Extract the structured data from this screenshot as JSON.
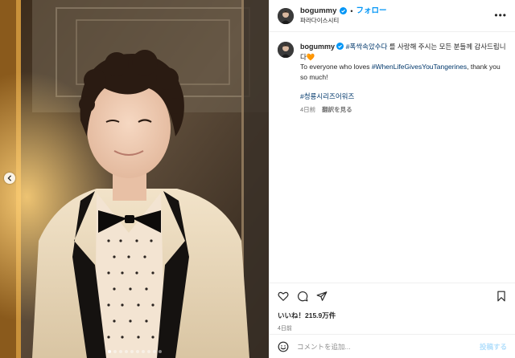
{
  "post": {
    "username": "bogummy",
    "follow_label": "フォロー",
    "separator": "•",
    "location": "파라다이스시티",
    "more_icon": "more-horizontal-icon",
    "caption": {
      "username": "bogummy",
      "hashtag_1": "#폭싹속았수다",
      "text_1": " 를 사랑해 주시는 모든 분들께 감사드립니다",
      "emoji": "🧡",
      "line_2_prefix": "To everyone who loves ",
      "hashtag_2": "#WhenLifeGivesYouTangerines",
      "line_2_suffix": ", thank you so much!",
      "hashtag_3": "#청룡시리즈어워즈",
      "time": "4日前",
      "translate_label": "翻訳を見る"
    },
    "actions": {
      "like_icon": "heart-icon",
      "comment_icon": "comment-icon",
      "share_icon": "send-icon",
      "save_icon": "bookmark-icon"
    },
    "likes": "いいね！215.9万件",
    "date": "4日前",
    "comment": {
      "placeholder": "コメントを追加...",
      "post_label": "投稿する",
      "emoji_icon": "smiley-icon"
    },
    "carousel": {
      "prev_icon": "chevron-left-icon",
      "slides": 10,
      "active_index": 0
    }
  },
  "colors": {
    "accent": "#0095f6",
    "hashtag": "#00376b",
    "muted": "#737373",
    "post_disabled": "#b2dffc",
    "border": "#efefef"
  }
}
